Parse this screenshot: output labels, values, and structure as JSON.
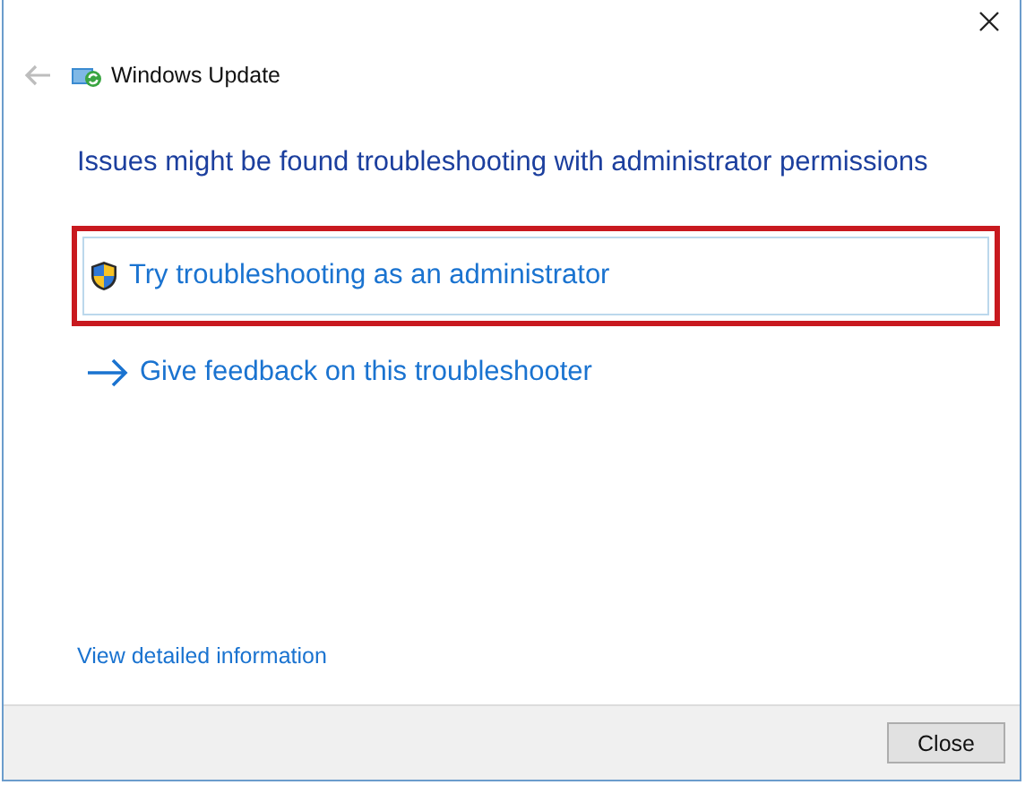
{
  "window": {
    "title": "Windows Update"
  },
  "heading": "Issues might be found troubleshooting with administrator permissions",
  "actions": [
    {
      "kind": "shield",
      "label": "Try troubleshooting as an administrator",
      "highlighted": true
    },
    {
      "kind": "arrow",
      "label": "Give feedback on this troubleshooter",
      "highlighted": false
    }
  ],
  "details_link": "View detailed information",
  "buttons": [
    "Close"
  ]
}
